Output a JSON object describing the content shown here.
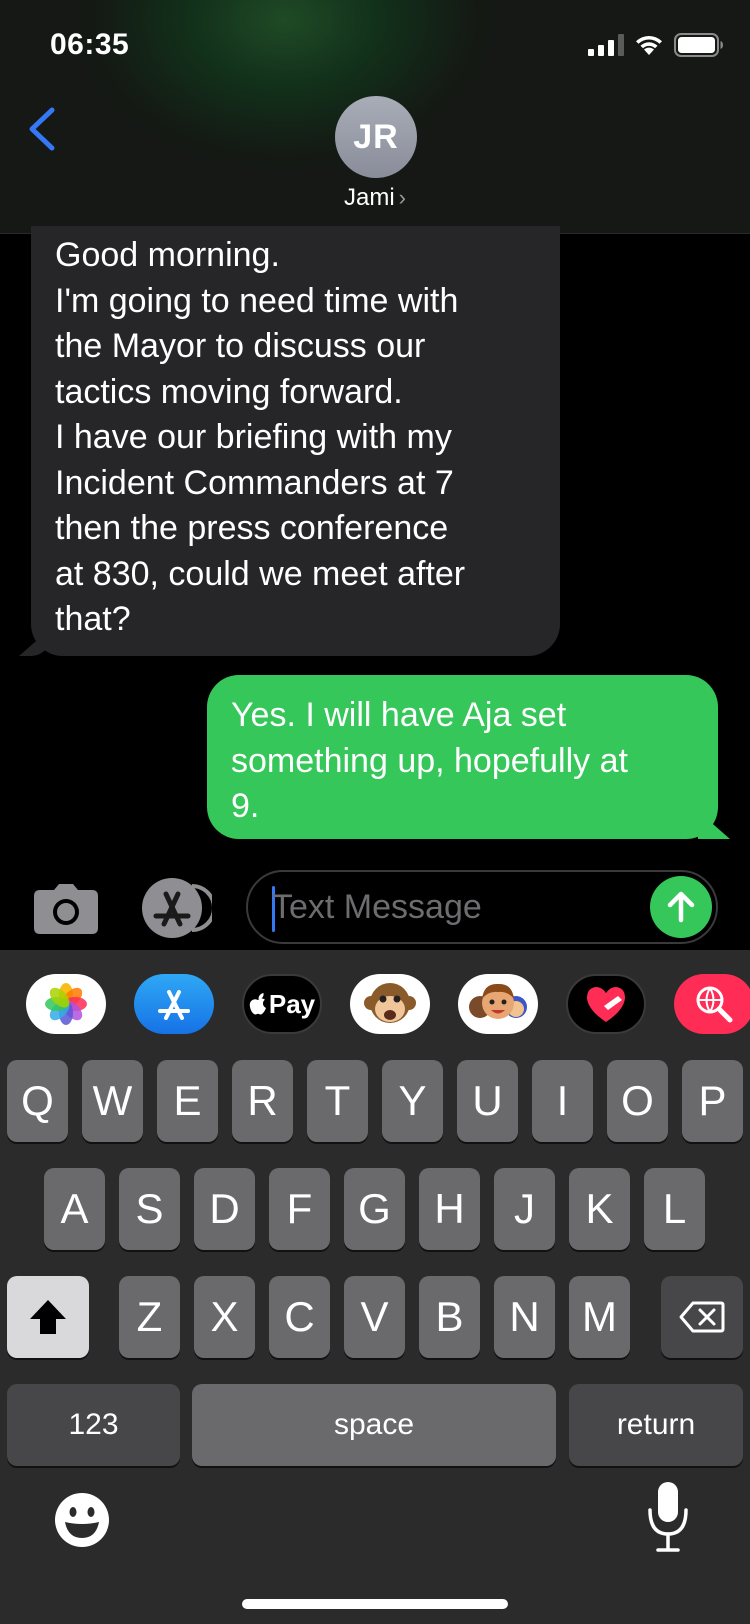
{
  "status": {
    "time": "06:35"
  },
  "header": {
    "avatar_initials": "JR",
    "contact_name": "Jami",
    "chevron": "›"
  },
  "messages": [
    {
      "direction": "received",
      "text": "Good morning.\nI'm going to need time with\nthe Mayor to discuss our\ntactics moving forward.\nI have our briefing with my\nIncident Commanders at 7\nthen the press conference\nat 830, could we meet after\nthat?"
    },
    {
      "direction": "sent",
      "text": "Yes. I will have Aja set\nsomething up, hopefully at\n9."
    }
  ],
  "composer": {
    "placeholder": "Text Message"
  },
  "app_strip": [
    {
      "name": "photos-app-icon"
    },
    {
      "name": "app-store-icon"
    },
    {
      "name": "apple-pay-icon",
      "label": "Pay"
    },
    {
      "name": "animoji-monkey-icon"
    },
    {
      "name": "memoji-icon"
    },
    {
      "name": "digital-touch-icon"
    },
    {
      "name": "image-search-icon"
    }
  ],
  "keyboard": {
    "row1": [
      "Q",
      "W",
      "E",
      "R",
      "T",
      "Y",
      "U",
      "I",
      "O",
      "P"
    ],
    "row2": [
      "A",
      "S",
      "D",
      "F",
      "G",
      "H",
      "J",
      "K",
      "L"
    ],
    "row3": [
      "Z",
      "X",
      "C",
      "V",
      "B",
      "N",
      "M"
    ],
    "numbers_label": "123",
    "space_label": "space",
    "return_label": "return"
  },
  "colors": {
    "sent_bubble": "#35c759",
    "received_bubble": "#262628",
    "accent_blue": "#3478f6",
    "key": "#6a6a6c",
    "key_dark": "#474749",
    "keyboard_bg": "#2b2b2c"
  }
}
